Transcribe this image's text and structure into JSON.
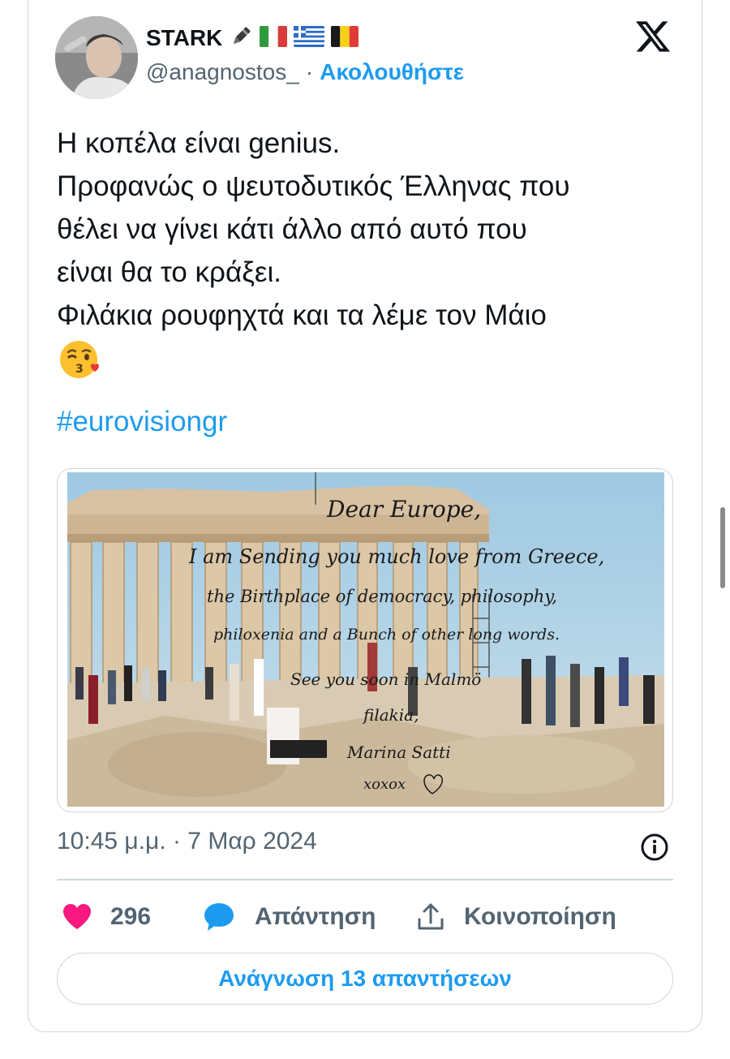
{
  "author": {
    "name": "STARK",
    "handle": "@anagnostos_",
    "separator": "·",
    "follow_label": "Ακολουθήστε",
    "badges": [
      "pen-icon",
      "flag-italy-icon",
      "flag-greece-icon",
      "flag-belgium-icon"
    ]
  },
  "platform": {
    "logo": "x-logo-icon"
  },
  "tweet": {
    "lines": [
      "Η κοπέλα είναι genius.",
      "Προφανώς ο ψευτοδυτικός Έλληνας που",
      "θέλει να γίνει κάτι άλλο από αυτό που",
      "είναι θα το κράξει.",
      "Φιλάκια ρουφηχτά και τα λέμε τον Μάιο"
    ],
    "emoji": "face-blowing-kiss-icon",
    "hashtag": "#eurovisiongr"
  },
  "media": {
    "description_icon": "parthenon-photo",
    "handwriting": [
      "Dear Europe,",
      "I am Sending you much love from Greece,",
      "the Birthplace of democracy, philosophy,",
      "philoxenia and a Bunch of other long words.",
      "See you soon in Malmö",
      "filakia,",
      "Marina Satti",
      "xoxox"
    ]
  },
  "meta": {
    "timestamp": "10:45 μ.μ. · 7 Μαρ 2024"
  },
  "actions": {
    "likes": "296",
    "reply_label": "Απάντηση",
    "share_label": "Κοινοποίηση"
  },
  "read_replies_label": "Ανάγνωση 13 απαντήσεων",
  "colors": {
    "accent": "#1d9bf0",
    "like": "#f91880",
    "muted": "#536471",
    "border": "#cfd9de"
  }
}
